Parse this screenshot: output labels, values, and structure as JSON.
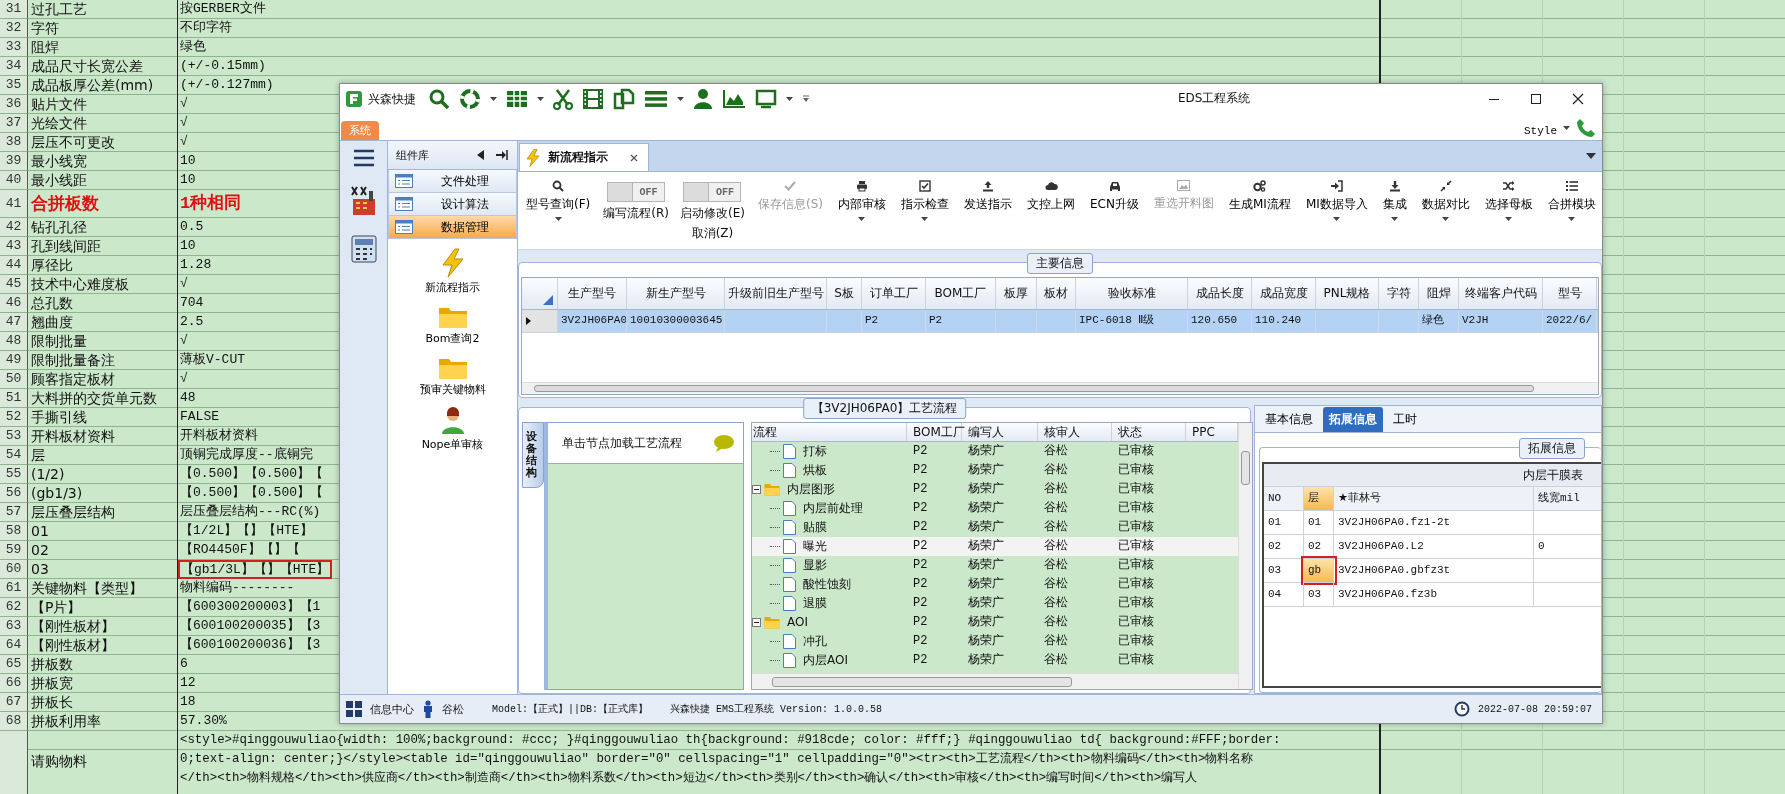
{
  "sheet": {
    "rows": [
      {
        "number": "31",
        "label": "过孔工艺",
        "value": "按GERBER文件",
        "emphasized": false
      },
      {
        "number": "32",
        "label": "字符",
        "value": "不印字符",
        "emphasized": false
      },
      {
        "number": "33",
        "label": "阻焊",
        "value": "绿色",
        "emphasized": false
      },
      {
        "number": "34",
        "label": "成品尺寸长宽公差",
        "value": "(+/-0.15mm)",
        "emphasized": false
      },
      {
        "number": "35",
        "label": "成品板厚公差(mm)",
        "value": "(+/-0.127mm)",
        "emphasized": false
      },
      {
        "number": "36",
        "label": "贴片文件",
        "value": "√",
        "emphasized": false
      },
      {
        "number": "37",
        "label": "光绘文件",
        "value": "√",
        "emphasized": false
      },
      {
        "number": "38",
        "label": "层压不可更改",
        "value": "√",
        "emphasized": false
      },
      {
        "number": "39",
        "label": "最小线宽",
        "value": "10",
        "emphasized": false
      },
      {
        "number": "40",
        "label": "最小线距",
        "value": "10",
        "emphasized": false
      },
      {
        "number": "41",
        "label": "合拼板数",
        "value": "1种相同",
        "emphasized": true
      },
      {
        "number": "42",
        "label": "钻孔孔径",
        "value": "0.5",
        "emphasized": false
      },
      {
        "number": "43",
        "label": "孔到线间距",
        "value": "10",
        "emphasized": false
      },
      {
        "number": "44",
        "label": "厚径比",
        "value": "1.28",
        "emphasized": false
      },
      {
        "number": "45",
        "label": "技术中心难度板",
        "value": "√",
        "emphasized": false
      },
      {
        "number": "46",
        "label": "总孔数",
        "value": "704",
        "emphasized": false
      },
      {
        "number": "47",
        "label": "翘曲度",
        "value": "2.5",
        "emphasized": false
      },
      {
        "number": "48",
        "label": "限制批量",
        "value": "√",
        "emphasized": false
      },
      {
        "number": "49",
        "label": "限制批量备注",
        "value": "薄板V-CUT",
        "emphasized": false
      },
      {
        "number": "50",
        "label": "顾客指定板材",
        "value": "√",
        "emphasized": false
      },
      {
        "number": "51",
        "label": "大料拼的交货单元数",
        "value": "48",
        "emphasized": false
      },
      {
        "number": "52",
        "label": "手撕引线",
        "value": "FALSE",
        "emphasized": false
      },
      {
        "number": "53",
        "label": "开料板材资料",
        "value": "开料板材资料",
        "emphasized": false
      },
      {
        "number": "54",
        "label": "层",
        "value": "顶铜完成厚度--底铜完",
        "emphasized": false
      },
      {
        "number": "55",
        "label": "(1/2)",
        "value": "【0.500】【0.500】【",
        "emphasized": false
      },
      {
        "number": "56",
        "label": "(gb1/3)",
        "value": "【0.500】【0.500】【",
        "emphasized": false
      },
      {
        "number": "57",
        "label": "层压叠层结构",
        "value": "层压叠层结构---RC(%)",
        "emphasized": false
      },
      {
        "number": "58",
        "label": "01",
        "value": "【1/2L】【】【HTE】",
        "emphasized": false
      },
      {
        "number": "59",
        "label": "02",
        "value": "【RO4450F】【】【",
        "emphasized": false
      },
      {
        "number": "60",
        "label": "03",
        "value": "【gb1/3L】【】【HTE】",
        "emphasized": false
      },
      {
        "number": "61",
        "label": "关键物料【类型】",
        "value": "物料编码--------",
        "emphasized": false
      },
      {
        "number": "62",
        "label": "【P片】",
        "value": "【600300200003】【1",
        "emphasized": false
      },
      {
        "number": "63",
        "label": "【刚性板材】",
        "value": "【600100200035】【3",
        "emphasized": false
      },
      {
        "number": "64",
        "label": "【刚性板材】",
        "value": "【600100200036】【3",
        "emphasized": false
      },
      {
        "number": "65",
        "label": "拼板数",
        "value": "6",
        "emphasized": false
      },
      {
        "number": "66",
        "label": "拼板宽",
        "value": "12",
        "emphasized": false
      },
      {
        "number": "67",
        "label": "拼板长",
        "value": "18",
        "emphasized": false
      },
      {
        "number": "68",
        "label": "拼板利用率",
        "value": "57.30%",
        "emphasized": false
      }
    ],
    "last_row": {
      "label": "请购物料",
      "value_lines": [
        "<style>#qinggouwuliao{width: 100%;background: #ccc; }#qinggouwuliao th{background: #918cde; color: #fff;} #qinggouwuliao td{ background:#FFF;border:",
        "0;text-align: center;}</style><table id=\"qinggouwuliao\" border=\"0\" cellspacing=\"1\" cellpadding=\"0\"><tr><th>工艺流程</th><th>物料编码</th><th>物料名称",
        "</th><th>物料规格</th><th>供应商</th><th>制造商</th><th>物料系数</th><th>短边</th><th>类别</th><th>确认</th><th>审核</th><th>编写时间</th><th>编写人"
      ]
    }
  },
  "window": {
    "brand": "兴森快捷",
    "title": "EDS工程系统",
    "menu_tab": "系统",
    "style_menu": "Style"
  },
  "component_panel": {
    "title": "组件库",
    "groups": [
      {
        "label": "文件处理",
        "selected": false
      },
      {
        "label": "设计算法",
        "selected": false
      },
      {
        "label": "数据管理",
        "selected": true
      }
    ],
    "shortcuts": [
      {
        "label": "新流程指示",
        "kind": "bolt"
      },
      {
        "label": "Bom查询2",
        "kind": "folder"
      },
      {
        "label": "预审关键物料",
        "kind": "folder"
      },
      {
        "label": "Nope单审核",
        "kind": "person"
      }
    ]
  },
  "document_tab": {
    "label": "新流程指示"
  },
  "ribbon": [
    {
      "kind": "button",
      "label": "型号查询(F)",
      "disabled": false,
      "dropdown": true
    },
    {
      "kind": "toggle",
      "state_text": "OFF",
      "label": "编写流程(R)",
      "on": false
    },
    {
      "kind": "toggle",
      "state_text": "OFF",
      "label": "启动修改(E)",
      "sublabel": "取消(Z)",
      "on": false
    },
    {
      "kind": "button",
      "label": "保存信息(S)",
      "disabled": true,
      "dropdown": false
    },
    {
      "kind": "button",
      "label": "内部审核",
      "disabled": false,
      "dropdown": true
    },
    {
      "kind": "button",
      "label": "指示检查",
      "disabled": false,
      "dropdown": true
    },
    {
      "kind": "button",
      "label": "发送指示",
      "disabled": false,
      "dropdown": false
    },
    {
      "kind": "button",
      "label": "文控上网",
      "disabled": false,
      "dropdown": false
    },
    {
      "kind": "button",
      "label": "ECN升级",
      "disabled": false,
      "dropdown": false
    },
    {
      "kind": "button",
      "label": "重选开料图",
      "disabled": true,
      "dropdown": false
    },
    {
      "kind": "button",
      "label": "生成MI流程",
      "disabled": false,
      "dropdown": false
    },
    {
      "kind": "button",
      "label": "MI数据导入",
      "disabled": false,
      "dropdown": true
    },
    {
      "kind": "button",
      "label": "集成",
      "disabled": false,
      "dropdown": true
    },
    {
      "kind": "button",
      "label": "数据对比",
      "disabled": false,
      "dropdown": true
    },
    {
      "kind": "button",
      "label": "选择母板",
      "disabled": false,
      "dropdown": true
    },
    {
      "kind": "button",
      "label": "合拼模块",
      "disabled": false,
      "dropdown": true
    }
  ],
  "main_info": {
    "title": "主要信息",
    "columns": [
      "生产型号",
      "新生产型号",
      "升级前旧生产型号",
      "S板",
      "订单工厂",
      "BOM工厂",
      "板厚",
      "板材",
      "验收标准",
      "成品长度",
      "成品宽度",
      "PNL规格",
      "字符",
      "阻焊",
      "终端客户代码",
      "型号"
    ],
    "rows": [
      {
        "selected": true,
        "cells": [
          "3V2JH06PA0",
          "10010300003645",
          "",
          "",
          "P2",
          "P2",
          "",
          "",
          "IPC-6018 Ⅱ级",
          "120.650",
          "110.240",
          "",
          "",
          "绿色",
          "V2JH",
          "2022/6/"
        ]
      }
    ]
  },
  "process_flow": {
    "title": "【3V2JH06PA0】工艺流程",
    "side_tab": "设备结构",
    "hint": "单击节点加载工艺流程",
    "columns": [
      "流程",
      "BOM工厂",
      "编写人",
      "核审人",
      "状态",
      "PPC"
    ],
    "tree": [
      {
        "children": [
          {
            "kind": "step",
            "label": "打标",
            "bom_factory": "P2",
            "author": "杨荣广",
            "reviewer": "谷松",
            "status": "已审核",
            "selected": false
          },
          {
            "kind": "step",
            "label": "烘板",
            "bom_factory": "P2",
            "author": "杨荣广",
            "reviewer": "谷松",
            "status": "已审核",
            "selected": false
          }
        ]
      },
      {
        "kind": "folder",
        "label": "内层图形",
        "bom_factory": "P2",
        "author": "杨荣广",
        "reviewer": "谷松",
        "status": "已审核",
        "selected": false,
        "expanded": true,
        "children": [
          {
            "kind": "step",
            "label": "内层前处理",
            "bom_factory": "P2",
            "author": "杨荣广",
            "reviewer": "谷松",
            "status": "已审核",
            "selected": false
          },
          {
            "kind": "step",
            "label": "贴膜",
            "bom_factory": "P2",
            "author": "杨荣广",
            "reviewer": "谷松",
            "status": "已审核",
            "selected": false
          },
          {
            "kind": "step",
            "label": "曝光",
            "bom_factory": "P2",
            "author": "杨荣广",
            "reviewer": "谷松",
            "status": "已审核",
            "selected": true
          },
          {
            "kind": "step",
            "label": "显影",
            "bom_factory": "P2",
            "author": "杨荣广",
            "reviewer": "谷松",
            "status": "已审核",
            "selected": false
          },
          {
            "kind": "step",
            "label": "酸性蚀刻",
            "bom_factory": "P2",
            "author": "杨荣广",
            "reviewer": "谷松",
            "status": "已审核",
            "selected": false
          },
          {
            "kind": "step",
            "label": "退膜",
            "bom_factory": "P2",
            "author": "杨荣广",
            "reviewer": "谷松",
            "status": "已审核",
            "selected": false
          }
        ]
      },
      {
        "kind": "folder",
        "label": "AOI",
        "bom_factory": "P2",
        "author": "杨荣广",
        "reviewer": "谷松",
        "status": "已审核",
        "selected": false,
        "expanded": true,
        "children": [
          {
            "kind": "step",
            "label": "冲孔",
            "bom_factory": "P2",
            "author": "杨荣广",
            "reviewer": "谷松",
            "status": "已审核",
            "selected": false
          },
          {
            "kind": "step",
            "label": "内层AOI",
            "bom_factory": "P2",
            "author": "杨荣广",
            "reviewer": "谷松",
            "status": "已审核",
            "selected": false
          }
        ]
      }
    ]
  },
  "detail_panel": {
    "tabs": [
      {
        "label": "基本信息",
        "selected": false
      },
      {
        "label": "拓展信息",
        "selected": true
      },
      {
        "label": "工时",
        "selected": false
      }
    ],
    "group_title": "拓展信息",
    "table_title": "内层干膜表",
    "columns": [
      "NO",
      "层",
      "★菲林号",
      "线宽mil"
    ],
    "rows": [
      {
        "cells": [
          "01",
          "01",
          "3V2JH06PA0.fz1-2t",
          ""
        ],
        "selected": false
      },
      {
        "cells": [
          "02",
          "02",
          "3V2JH06PA0.L2",
          "0"
        ],
        "selected": false
      },
      {
        "cells": [
          "03",
          "gb",
          "3V2JH06PA0.gbfz3t",
          ""
        ],
        "selected": true
      },
      {
        "cells": [
          "04",
          "03",
          "3V2JH06PA0.fz3b",
          ""
        ],
        "selected": false
      }
    ]
  },
  "status_bar": {
    "info_center": "信息中心",
    "user": "谷松",
    "model": "Model:【正式】||DB:【正式库】",
    "app": "兴森快捷 EMS工程系统 Version: 1.0.0.58",
    "datetime": "2022-07-08 20:59:07"
  }
}
